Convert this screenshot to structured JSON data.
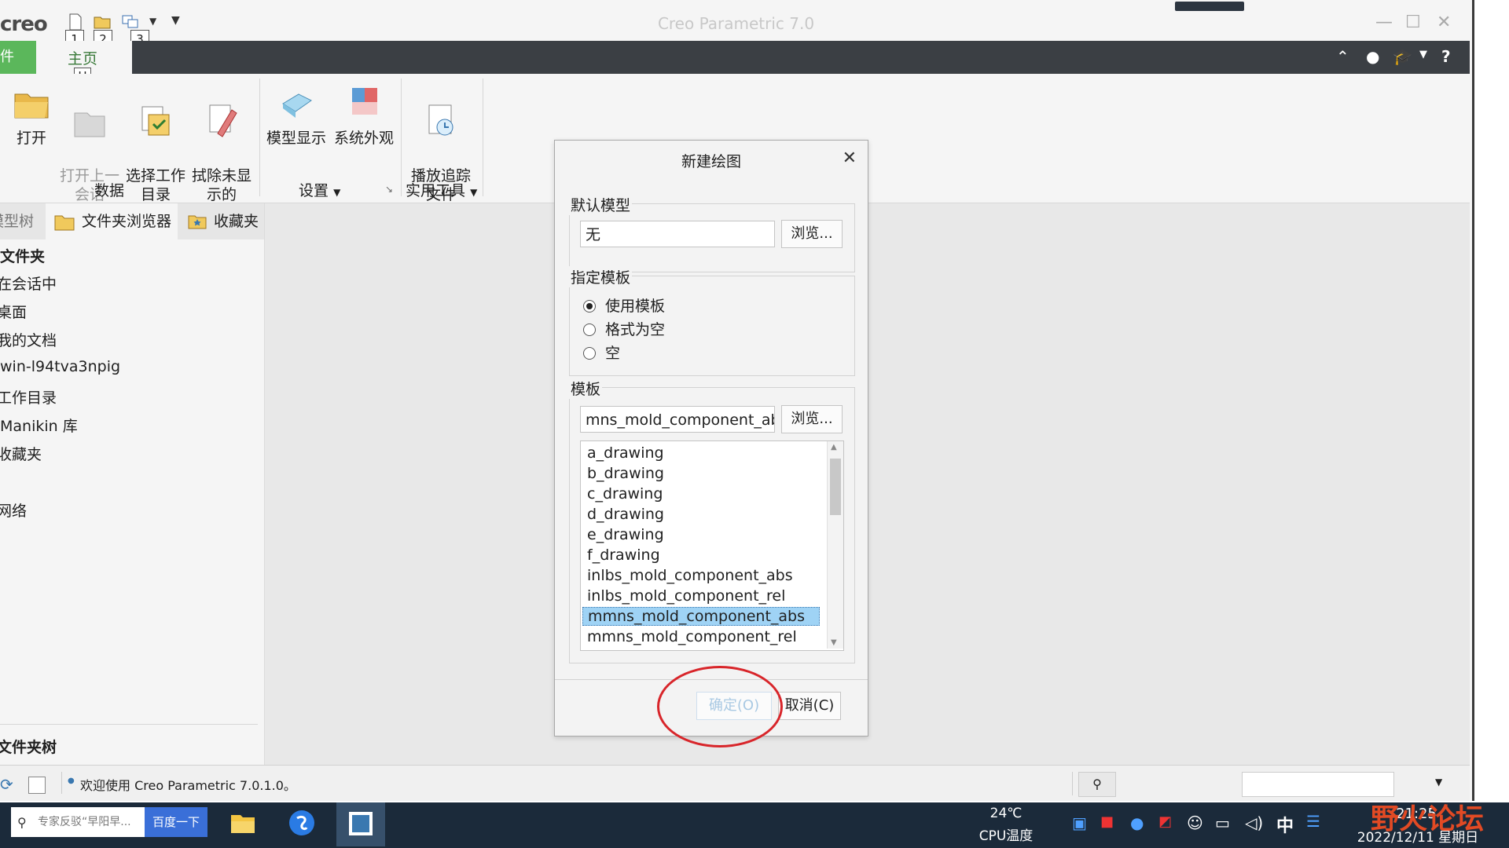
{
  "app": {
    "logo": "creo",
    "title": "Creo Parametric 7.0",
    "quick_access_numbers": [
      "1",
      "2",
      "3"
    ],
    "file_tab": "件",
    "home_tab": "主页",
    "home_tab_key": "H"
  },
  "ribbon": {
    "buttons": [
      {
        "label": "打开",
        "enabled": true
      },
      {
        "label": "打开上一\n会话",
        "enabled": false
      },
      {
        "label": "选择工作\n目录",
        "enabled": true
      },
      {
        "label": "拭除未显\n示的",
        "enabled": true
      },
      {
        "label": "模型显示",
        "enabled": true
      },
      {
        "label": "系统外观",
        "enabled": true
      },
      {
        "label": "播放追踪\n文件",
        "enabled": true
      }
    ],
    "groups": {
      "data": "数据",
      "settings": "设置",
      "utilities": "实用工具"
    }
  },
  "navigator": {
    "tabs": [
      "模型树",
      "文件夹浏览器",
      "收藏夹"
    ],
    "section_title": "文件夹",
    "items": [
      "在会话中",
      "桌面",
      "我的文档",
      "win-l94tva3npig",
      "工作目录",
      "Manikin 库",
      "收藏夹",
      "网络"
    ],
    "tree_title": "文件夹树"
  },
  "status": {
    "message": "欢迎使用 Creo Parametric 7.0.1.0。"
  },
  "dialog": {
    "title": "新建绘图",
    "default_model": {
      "legend": "默认模型",
      "value": "无",
      "browse": "浏览..."
    },
    "template_spec": {
      "legend": "指定模板",
      "options": [
        "使用模板",
        "格式为空",
        "空"
      ],
      "selected_index": 0
    },
    "template": {
      "legend": "模板",
      "value": "mns_mold_component_abs",
      "browse": "浏览...",
      "items": [
        "a_drawing",
        "b_drawing",
        "c_drawing",
        "d_drawing",
        "e_drawing",
        "f_drawing",
        "inlbs_mold_component_abs",
        "inlbs_mold_component_rel",
        "mmns_mold_component_abs",
        "mmns_mold_component_rel"
      ],
      "selected": "mmns_mold_component_abs"
    },
    "ok": "确定(O)",
    "cancel": "取消(C)"
  },
  "taskbar": {
    "search_placeholder": "专家反驳“早阳早...",
    "search_button": "百度一下",
    "temp": "24℃",
    "temp_label": "CPU温度",
    "ime": "中",
    "time": "21:25",
    "date": "2022/12/11 星期日"
  },
  "watermark": "野火论坛",
  "colors": {
    "file_tab": "#5bb75b",
    "ribbon_bar": "#3b3f44",
    "selection": "#9fd3f5",
    "annotation": "#d8252a"
  }
}
